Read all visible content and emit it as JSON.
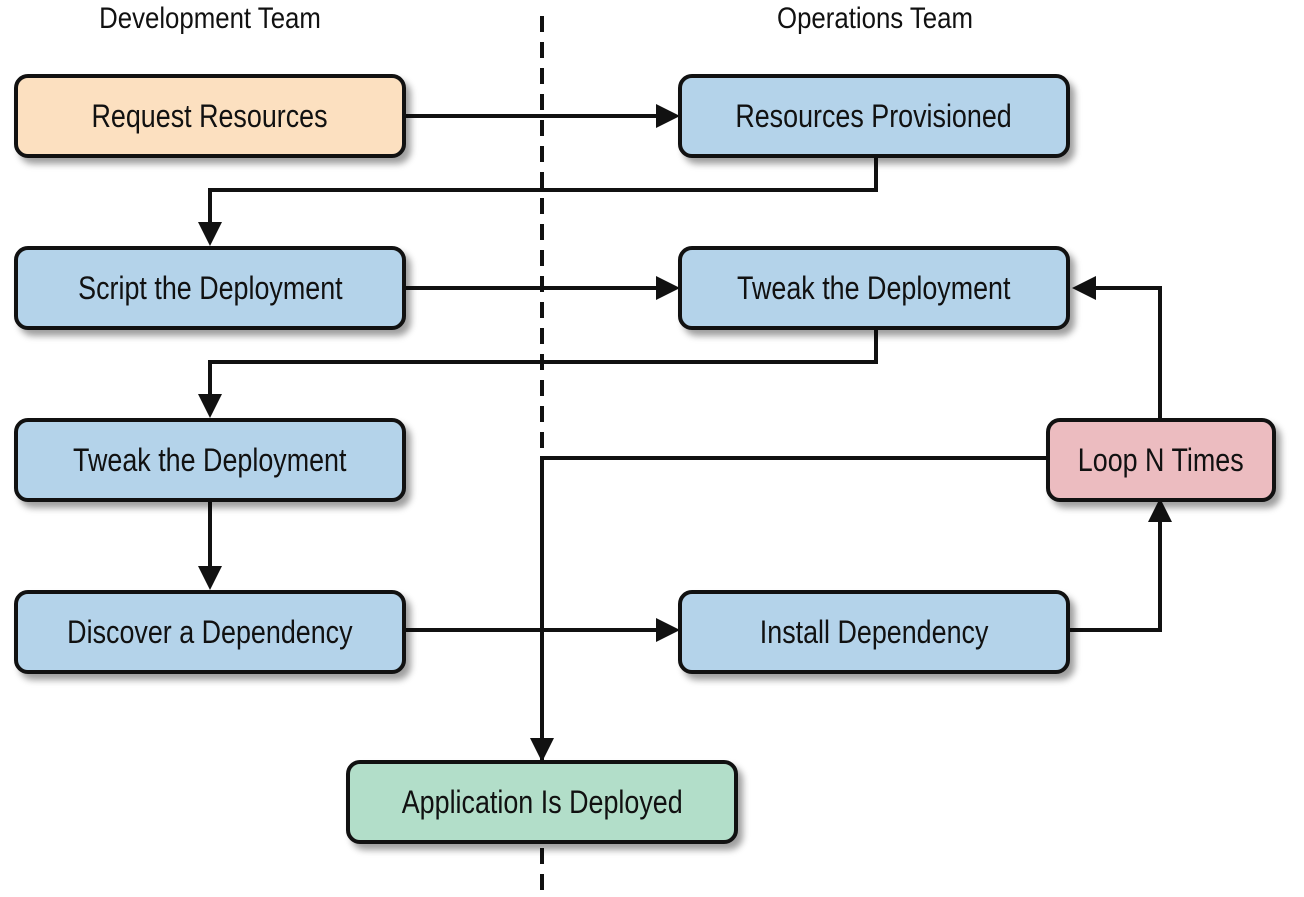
{
  "lanes": {
    "left": "Development Team",
    "right": "Operations Team"
  },
  "colors": {
    "request": "#fce0c0",
    "step": "#b4d3ea",
    "loop": "#ecbcc0",
    "done": "#b2dec9",
    "stroke": "#111111"
  },
  "nodes": {
    "request_resources": "Request Resources",
    "resources_provisioned": "Resources Provisioned",
    "script_deployment": "Script the Deployment",
    "tweak_deployment_ops": "Tweak the Deployment",
    "tweak_deployment_dev": "Tweak the Deployment",
    "discover_dependency": "Discover a Dependency",
    "install_dependency": "Install Dependency",
    "loop_n_times": "Loop N Times",
    "application_deployed": "Application Is Deployed"
  },
  "edges": [
    {
      "from": "request_resources",
      "to": "resources_provisioned"
    },
    {
      "from": "resources_provisioned",
      "to": "script_deployment"
    },
    {
      "from": "script_deployment",
      "to": "tweak_deployment_ops"
    },
    {
      "from": "tweak_deployment_ops",
      "to": "tweak_deployment_dev"
    },
    {
      "from": "tweak_deployment_dev",
      "to": "discover_dependency"
    },
    {
      "from": "discover_dependency",
      "to": "install_dependency"
    },
    {
      "from": "install_dependency",
      "to": "loop_n_times"
    },
    {
      "from": "loop_n_times",
      "to": "tweak_deployment_ops"
    },
    {
      "from": "loop_n_times",
      "to": "application_deployed"
    }
  ]
}
